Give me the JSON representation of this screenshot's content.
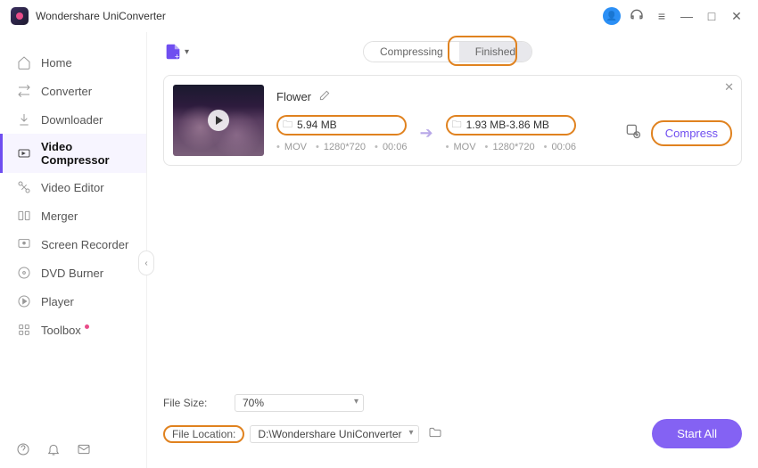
{
  "app": {
    "title": "Wondershare UniConverter"
  },
  "sidebar": {
    "items": [
      {
        "label": "Home",
        "icon": "home"
      },
      {
        "label": "Converter",
        "icon": "converter"
      },
      {
        "label": "Downloader",
        "icon": "downloader"
      },
      {
        "label": "Video Compressor",
        "icon": "compressor",
        "active": true
      },
      {
        "label": "Video Editor",
        "icon": "editor"
      },
      {
        "label": "Merger",
        "icon": "merger"
      },
      {
        "label": "Screen Recorder",
        "icon": "recorder"
      },
      {
        "label": "DVD Burner",
        "icon": "dvd"
      },
      {
        "label": "Player",
        "icon": "player"
      },
      {
        "label": "Toolbox",
        "icon": "toolbox",
        "has_dot": true
      }
    ]
  },
  "tabs": {
    "compressing": "Compressing",
    "finished": "Finished"
  },
  "card": {
    "title": "Flower",
    "source": {
      "size": "5.94 MB",
      "format": "MOV",
      "resolution": "1280*720",
      "duration": "00:06"
    },
    "target": {
      "size": "1.93 MB-3.86 MB",
      "format": "MOV",
      "resolution": "1280*720",
      "duration": "00:06"
    },
    "compress_label": "Compress"
  },
  "bottom": {
    "filesize_label": "File Size:",
    "filesize_value": "70%",
    "location_label": "File Location:",
    "location_value": "D:\\Wondershare UniConverter",
    "startall": "Start All"
  }
}
